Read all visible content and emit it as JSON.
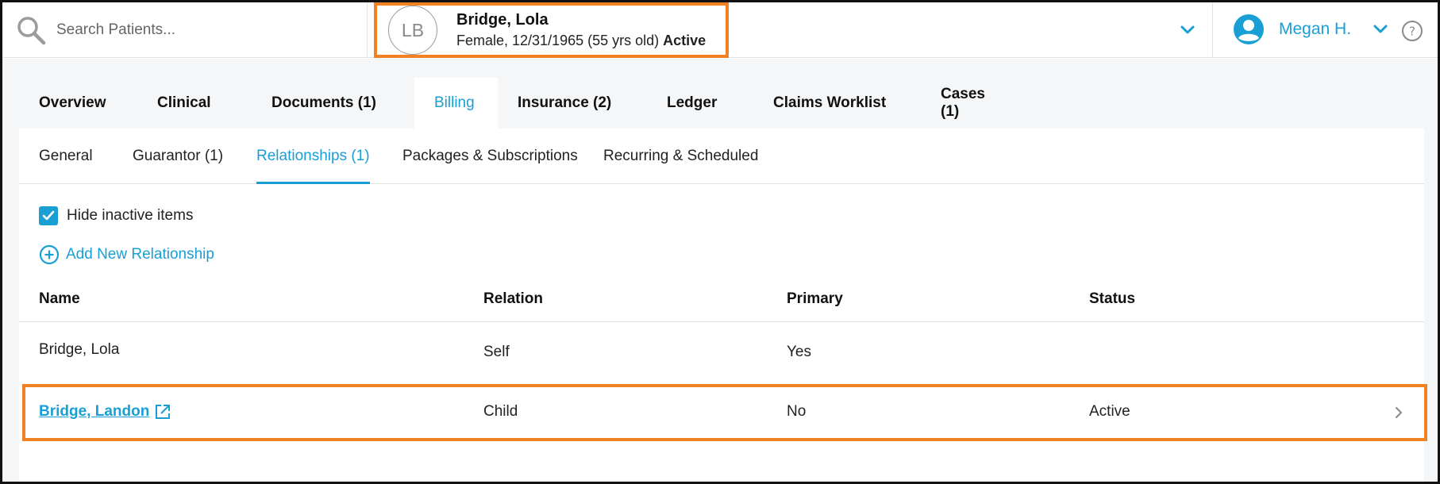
{
  "search": {
    "placeholder": "Search Patients..."
  },
  "patient": {
    "initials": "LB",
    "name": "Bridge, Lola",
    "details": "Female, 12/31/1965 (55 yrs old)",
    "status": "Active"
  },
  "user": {
    "name": "Megan H."
  },
  "tabs": [
    {
      "label": "Overview"
    },
    {
      "label": "Clinical"
    },
    {
      "label": "Documents (1)"
    },
    {
      "label": "Billing"
    },
    {
      "label": "Insurance (2)"
    },
    {
      "label": "Ledger"
    },
    {
      "label": "Claims Worklist"
    },
    {
      "label": "Cases (1)"
    }
  ],
  "subtabs": [
    {
      "label": "General"
    },
    {
      "label": "Guarantor (1)"
    },
    {
      "label": "Relationships (1)"
    },
    {
      "label": "Packages & Subscriptions"
    },
    {
      "label": "Recurring & Scheduled"
    }
  ],
  "filters": {
    "hide_inactive_label": "Hide inactive items",
    "hide_inactive_checked": true
  },
  "actions": {
    "add_relationship_label": "Add New Relationship"
  },
  "table": {
    "columns": [
      "Name",
      "Relation",
      "Primary",
      "Status"
    ],
    "rows": [
      {
        "name": "Bridge, Lola",
        "relation": "Self",
        "primary": "Yes",
        "status": ""
      },
      {
        "name": "Bridge, Landon",
        "relation": "Child",
        "primary": "No",
        "status": "Active"
      }
    ]
  },
  "colors": {
    "accent": "#1a9fd5",
    "highlight": "#f08124"
  },
  "icons": {
    "search": "search-icon",
    "expand": "chevron-down-icon",
    "user": "user-icon",
    "help": "help-icon",
    "check": "check-icon",
    "add": "plus-circle-icon",
    "external": "external-link-icon",
    "row": "chevron-right-icon"
  }
}
